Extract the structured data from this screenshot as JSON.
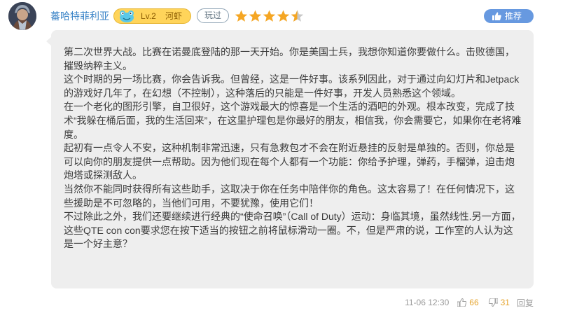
{
  "review": {
    "username": "蕃哈特菲利亚",
    "level": "Lv.2",
    "rank": "河虾",
    "played_tag": "玩过",
    "rating": 4.5,
    "recommend_label": "推荐",
    "paragraphs": [
      "第二次世界大战。比赛在诺曼底登陆的那一天开始。你是美国士兵，我想你知道你要做什么。击败德国，摧毁纳粹主义。",
      "这个时期的另一场比赛，你会告诉我。但曾经，这是一件好事。该系列因此，对于通过向幻灯片和Jetpack的游戏好几年了，在幻想（不控制），这种落后的只能是一件好事，开发人员熟悉这个领域。",
      "在一个老化的图形引擎，自卫很好，这个游戏最大的惊喜是一个生活的酒吧的外观。根本改变，完成了技术“我躲在桶后面，我的生活回来”，在这里护理包是你最好的朋友，相信我，你会需要它，如果你在老将难度。",
      "起初有一点令人不安，这种机制非常迅速，只有急救包才不会在附近悬挂的反射是单独的。否则，你总是可以向你的朋友提供一点帮助。因为他们现在每个人都有一个功能：你给予护理，弹药，手榴弹，迫击炮炮塔或探测敌人。",
      "当然你不能同时获得所有这些助手，这取决于你在任务中陪伴你的角色。这太容易了！在任何情况下，这些援助是不可忽略的，当他们可用，不要犹豫，使用它们！",
      "不过除此之外，我们还要继续进行经典的“使命召唤”（Call of Duty）运动：身临其境，虽然线性.另一方面，这些QTE con con要求您在按下适当的按钮之前将鼠标滑动一圈。不，但是严肃的说，工作室的人认为这是一个好主意？"
    ],
    "timestamp": "11-06 12:30",
    "likes": "66",
    "dislikes": "31",
    "reply_label": "回复"
  },
  "colors": {
    "username": "#3e86c8",
    "star": "#f5a623",
    "recommend_bg": "#6799e0",
    "bubble_bg": "#eeeeee",
    "count": "#e5a32b"
  },
  "icons": [
    "avatar",
    "frog-icon",
    "star-icon",
    "thumbs-up-icon",
    "thumbs-down-icon"
  ]
}
